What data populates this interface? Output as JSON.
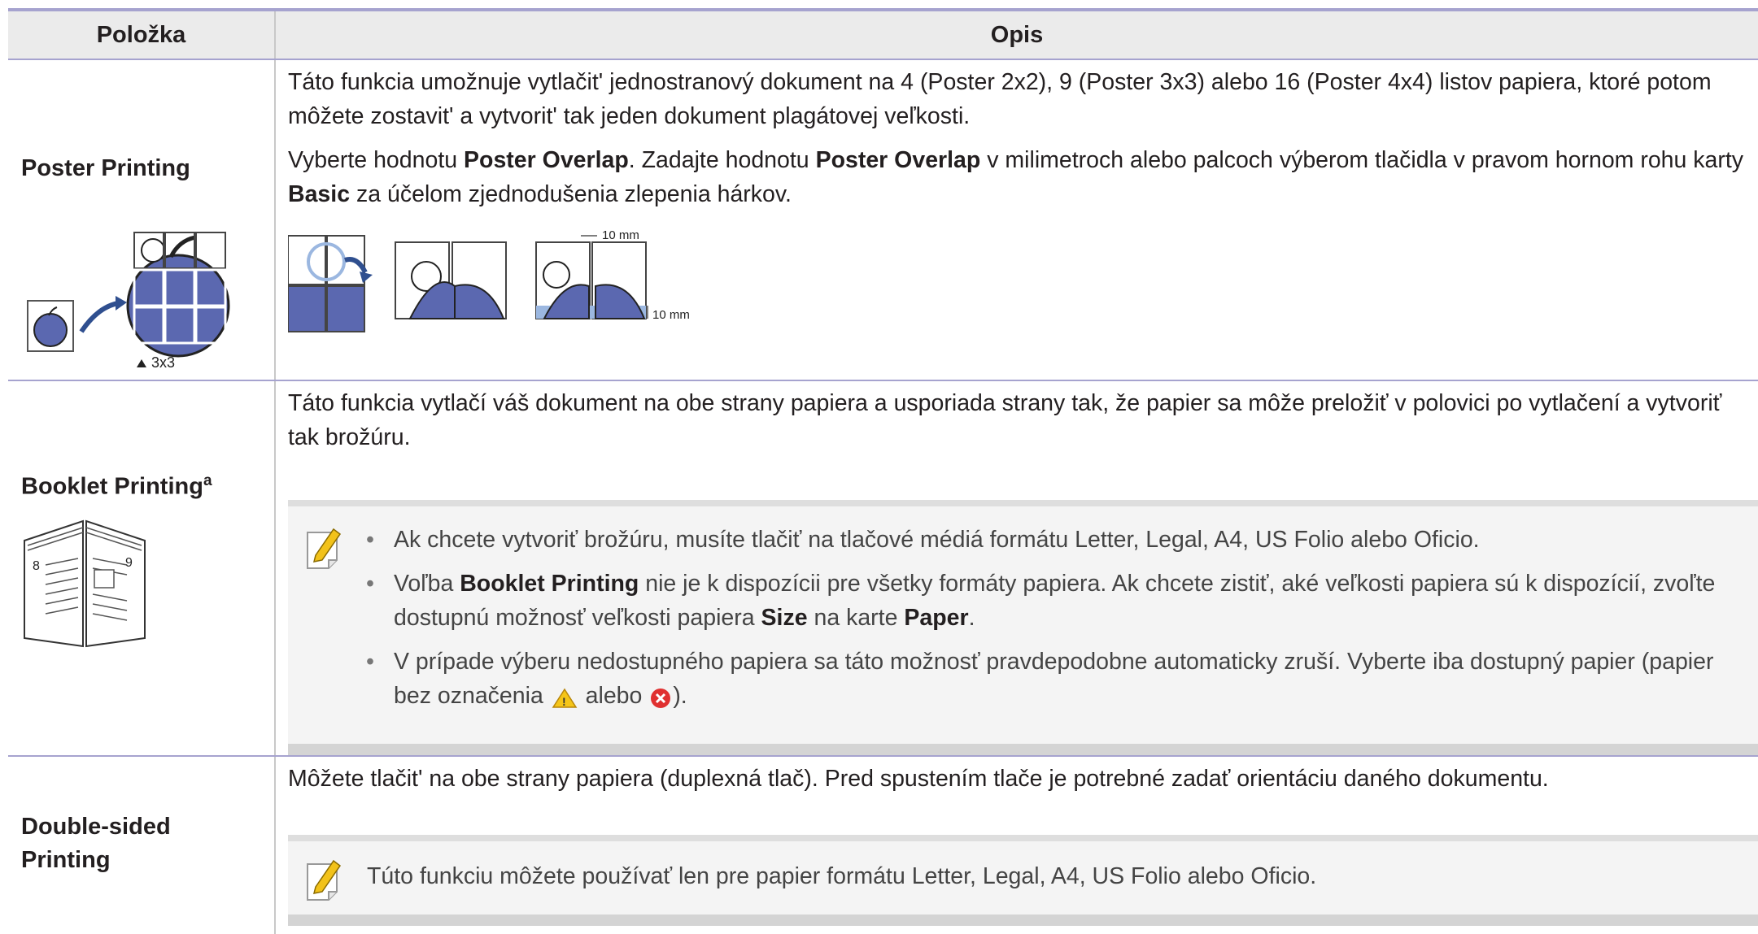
{
  "header": {
    "col1": "Položka",
    "col2": "Opis"
  },
  "poster": {
    "title": "Poster Printing",
    "grid_label": "3x3",
    "p1": "Táto funkcia umožnuje vytlačit' jednostranový dokument na 4 (Poster 2x2), 9 (Poster 3x3) alebo 16 (Poster 4x4) listov papiera, ktoré potom môžete zostavit' a vytvorit' tak jeden dokument plagátovej veľkosti.",
    "p2_a": "Vyberte hodnotu ",
    "p2_b": "Poster Overlap",
    "p2_c": ". Zadajte hodnotu ",
    "p2_d": "Poster Overlap",
    "p2_e": " v milimetroch alebo palcoch výberom tlačidla v pravom hornom rohu karty ",
    "p2_f": "Basic",
    "p2_g": " za účelom zjednodušenia zlepenia hárkov.",
    "overlap_label_1": "10 mm",
    "overlap_label_2": "10 mm"
  },
  "booklet": {
    "title": "Booklet Printing",
    "footnote": "a",
    "page_left": "8",
    "page_right": "9",
    "p1": "Táto funkcia vytlačí váš dokument na obe strany papiera a usporiada strany tak, že papier sa môže preložiť v polovici po vytlačení a vytvoriť tak brožúru.",
    "note1": "Ak chcete vytvoriť brožúru, musíte tlačiť na tlačové médiá formátu Letter, Legal, A4, US Folio alebo Oficio.",
    "note2_a": "Voľba ",
    "note2_b": "Booklet Printing",
    "note2_c": " nie je k dispozícii pre všetky formáty papiera. Ak chcete zistiť, aké veľkosti papiera sú k dispozícií, zvoľte dostupnú možnosť veľkosti papiera ",
    "note2_d": "Size",
    "note2_e": " na karte ",
    "note2_f": "Paper",
    "note2_g": ".",
    "note3_a": "V prípade výberu nedostupného papiera sa táto možnosť pravdepodobne automaticky zruší. Vyberte iba dostupný papier (papier bez označenia ",
    "note3_b": " alebo ",
    "note3_c": ")."
  },
  "duplex": {
    "title_1": "Double-sided",
    "title_2": "Printing",
    "p1": "Môžete tlačit' na obe strany papiera (duplexná tlač). Pred spustením tlače je potrebné zadať orientáciu daného dokumentu.",
    "note": "Túto funkciu môžete používať len pre papier formátu Letter, Legal, A4, US Folio alebo Oficio."
  },
  "colors": {
    "accent_line": "#a6a3cf",
    "header_bg": "#ebebeb",
    "apple": "#5b68b0"
  }
}
